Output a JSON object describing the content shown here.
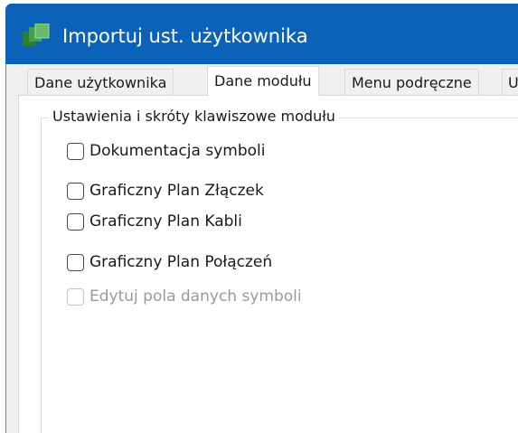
{
  "window": {
    "title": "Importuj ust. użytkownika",
    "icon": "app-icon"
  },
  "tabs": [
    {
      "label": "Dane użytkownika",
      "active": false
    },
    {
      "label": "Dane modułu",
      "active": true
    },
    {
      "label": "Menu podręczne",
      "active": false
    },
    {
      "label": "U",
      "active": false
    }
  ],
  "group": {
    "title": "Ustawienia i skróty klawiszowe modułu",
    "checkboxes": [
      {
        "label": "Dokumentacja symboli",
        "checked": false,
        "enabled": true
      },
      {
        "label": "Graficzny Plan Złączek",
        "checked": false,
        "enabled": true
      },
      {
        "label": "Graficzny Plan Kabli",
        "checked": false,
        "enabled": true
      },
      {
        "label": "Graficzny Plan Połączeń",
        "checked": false,
        "enabled": true
      },
      {
        "label": "Edytuj pola danych symboli",
        "checked": false,
        "enabled": false
      }
    ]
  },
  "colors": {
    "titlebar": "#0a63b8",
    "dialog_bg": "#f0f0f0",
    "panel_bg": "#ffffff",
    "disabled_text": "#9a9a9a"
  }
}
